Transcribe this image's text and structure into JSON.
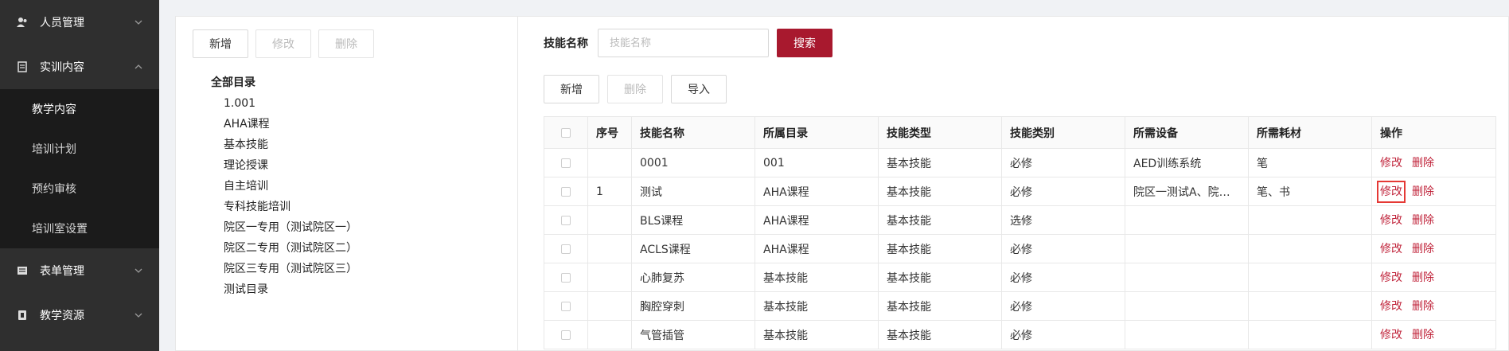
{
  "sidebar": {
    "groups": [
      {
        "label": "人员管理",
        "icon": "users-icon",
        "expanded": false
      },
      {
        "label": "实训内容",
        "icon": "book-icon",
        "expanded": true,
        "items": [
          {
            "label": "教学内容",
            "active": true
          },
          {
            "label": "培训计划",
            "active": false
          },
          {
            "label": "预约审核",
            "active": false
          },
          {
            "label": "培训室设置",
            "active": false
          }
        ]
      },
      {
        "label": "表单管理",
        "icon": "form-icon",
        "expanded": false
      },
      {
        "label": "教学资源",
        "icon": "resource-icon",
        "expanded": false
      }
    ]
  },
  "tree_pane": {
    "toolbar": {
      "add": "新增",
      "edit": "修改",
      "delete": "删除"
    },
    "root": "全部目录",
    "nodes": [
      "1.001",
      "AHA课程",
      "基本技能",
      "理论授课",
      "自主培训",
      "专科技能培训",
      "院区一专用（测试院区一）",
      "院区二专用（测试院区二）",
      "院区三专用（测试院区三）",
      "测试目录"
    ]
  },
  "search": {
    "label": "技能名称",
    "placeholder": "技能名称",
    "value": "",
    "button": "搜索"
  },
  "actions": {
    "add": "新增",
    "delete": "删除",
    "import": "导入"
  },
  "table": {
    "columns": [
      "",
      "序号",
      "技能名称",
      "所属目录",
      "技能类型",
      "技能类别",
      "所需设备",
      "所需耗材",
      "操作"
    ],
    "rows": [
      {
        "seq": "",
        "name": "0001",
        "dir": "001",
        "type": "基本技能",
        "category": "必修",
        "device": "AED训练系统",
        "material": "笔"
      },
      {
        "seq": "1",
        "name": "测试",
        "dir": "AHA课程",
        "type": "基本技能",
        "category": "必修",
        "device": "院区一测试A、院…",
        "material": "笔、书"
      },
      {
        "seq": "",
        "name": "BLS课程",
        "dir": "AHA课程",
        "type": "基本技能",
        "category": "选修",
        "device": "",
        "material": ""
      },
      {
        "seq": "",
        "name": "ACLS课程",
        "dir": "AHA课程",
        "type": "基本技能",
        "category": "必修",
        "device": "",
        "material": ""
      },
      {
        "seq": "",
        "name": "心肺复苏",
        "dir": "基本技能",
        "type": "基本技能",
        "category": "必修",
        "device": "",
        "material": ""
      },
      {
        "seq": "",
        "name": "胸腔穿刺",
        "dir": "基本技能",
        "type": "基本技能",
        "category": "必修",
        "device": "",
        "material": ""
      },
      {
        "seq": "",
        "name": "气管插管",
        "dir": "基本技能",
        "type": "基本技能",
        "category": "必修",
        "device": "",
        "material": ""
      }
    ],
    "op_edit": "修改",
    "op_delete": "删除"
  },
  "colors": {
    "primary": "#a8192e",
    "sidebar_bg": "#2f2f2f",
    "submenu_bg": "#1b1b1b",
    "link": "#c0243b"
  }
}
